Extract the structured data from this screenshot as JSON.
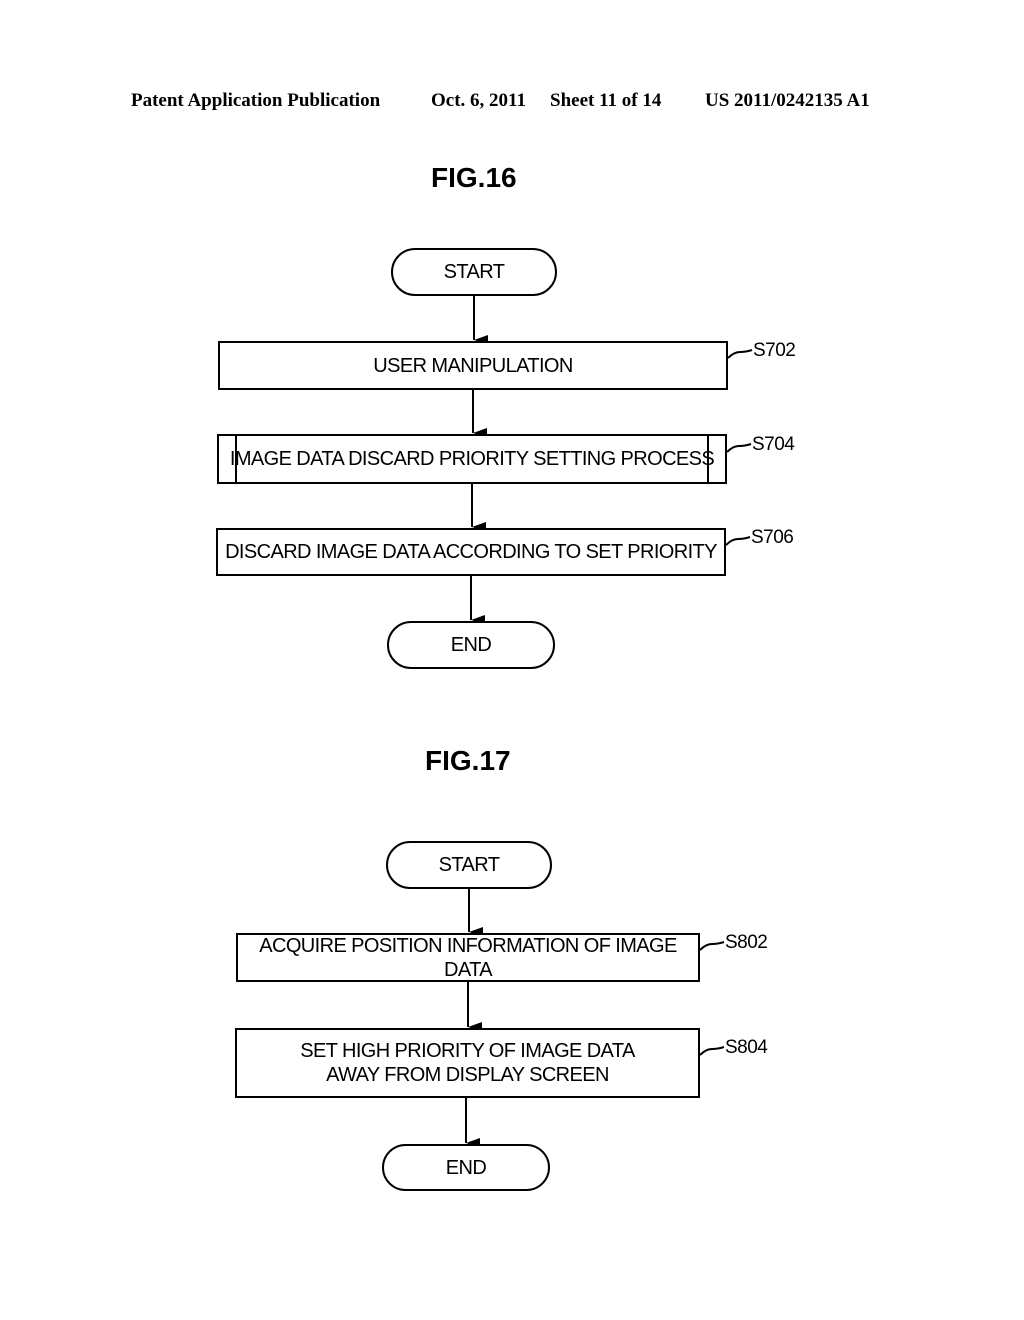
{
  "header": {
    "publication": "Patent Application Publication",
    "date": "Oct. 6, 2011",
    "sheet": "Sheet 11 of 14",
    "number": "US 2011/0242135 A1"
  },
  "fig16": {
    "title": "FIG.16",
    "start": "START",
    "steps": [
      {
        "id": "S702",
        "text": "USER MANIPULATION"
      },
      {
        "id": "S704",
        "text": "IMAGE DATA DISCARD PRIORITY SETTING PROCESS"
      },
      {
        "id": "S706",
        "text": "DISCARD IMAGE DATA ACCORDING TO SET PRIORITY"
      }
    ],
    "end": "END"
  },
  "fig17": {
    "title": "FIG.17",
    "start": "START",
    "steps": [
      {
        "id": "S802",
        "text": "ACQUIRE POSITION INFORMATION OF IMAGE DATA"
      },
      {
        "id": "S804",
        "text": "SET HIGH PRIORITY OF IMAGE DATA AWAY FROM DISPLAY SCREEN"
      }
    ],
    "end": "END"
  }
}
